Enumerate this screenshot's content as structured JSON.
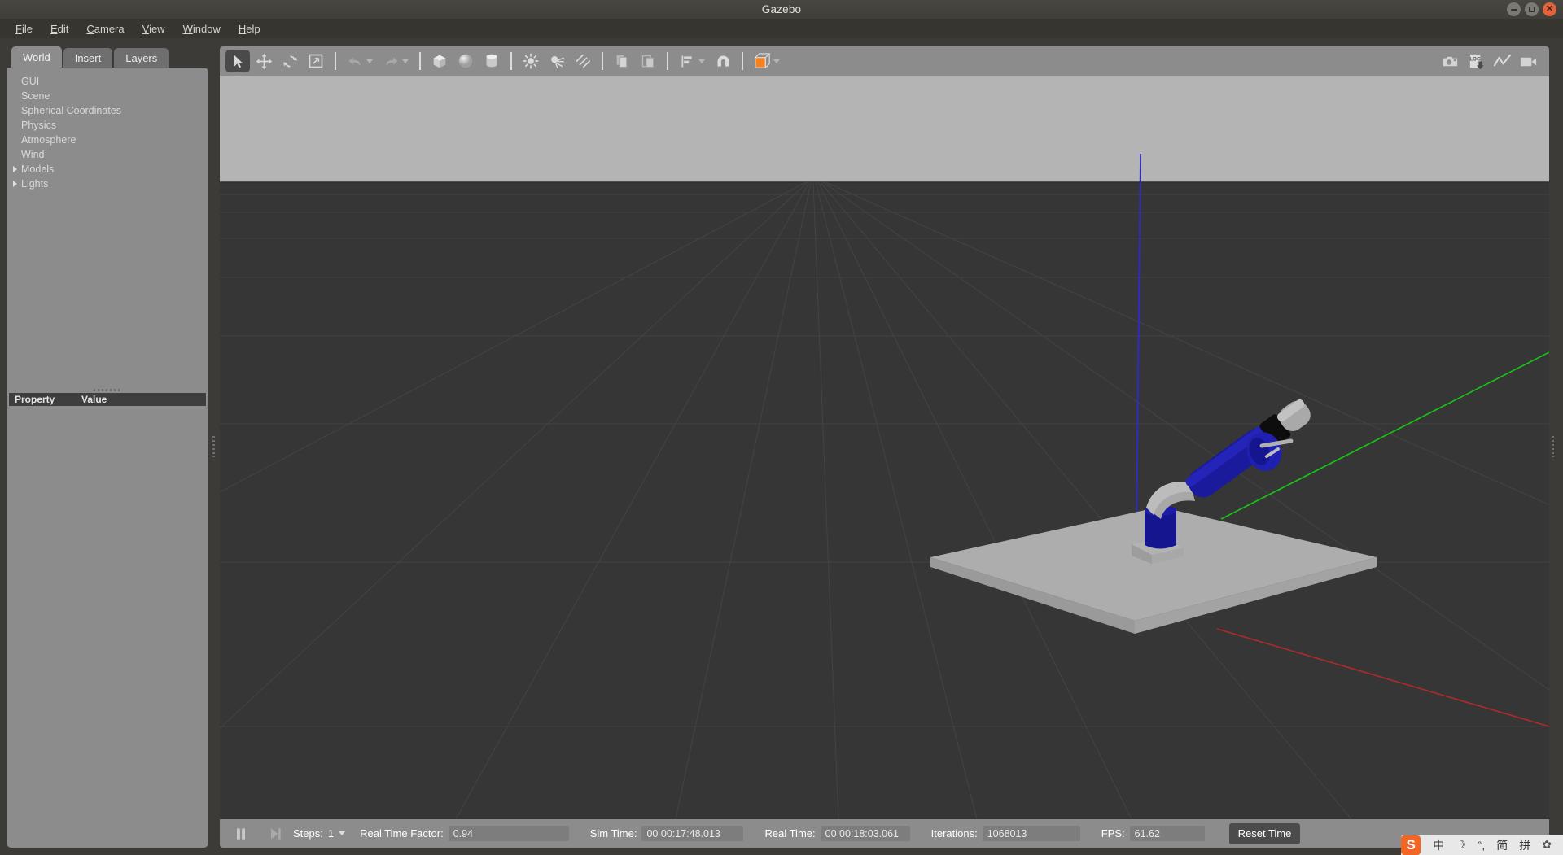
{
  "window": {
    "title": "Gazebo",
    "controls": [
      {
        "name": "minimize",
        "glyph": "dash"
      },
      {
        "name": "maximize",
        "glyph": "square"
      },
      {
        "name": "close",
        "glyph": "x"
      }
    ]
  },
  "menubar": {
    "items": [
      {
        "label": "File",
        "mnemonic": "F"
      },
      {
        "label": "Edit",
        "mnemonic": "E"
      },
      {
        "label": "Camera",
        "mnemonic": "C"
      },
      {
        "label": "View",
        "mnemonic": "V"
      },
      {
        "label": "Window",
        "mnemonic": "W"
      },
      {
        "label": "Help",
        "mnemonic": "H"
      }
    ]
  },
  "left_panel": {
    "tabs": [
      {
        "label": "World",
        "active": true
      },
      {
        "label": "Insert",
        "active": false
      },
      {
        "label": "Layers",
        "active": false
      }
    ],
    "tree": [
      {
        "label": "GUI",
        "expandable": false
      },
      {
        "label": "Scene",
        "expandable": false
      },
      {
        "label": "Spherical Coordinates",
        "expandable": false
      },
      {
        "label": "Physics",
        "expandable": false
      },
      {
        "label": "Atmosphere",
        "expandable": false
      },
      {
        "label": "Wind",
        "expandable": false
      },
      {
        "label": "Models",
        "expandable": true
      },
      {
        "label": "Lights",
        "expandable": true
      }
    ],
    "property_table": {
      "col_property": "Property",
      "col_value": "Value",
      "rows": []
    }
  },
  "toolbar": {
    "left_tools": [
      {
        "name": "select-mode",
        "title": "Selection Mode",
        "active": true
      },
      {
        "name": "translate-mode",
        "title": "Translation Mode",
        "active": false
      },
      {
        "name": "rotate-mode",
        "title": "Rotation Mode",
        "active": false
      },
      {
        "name": "scale-mode",
        "title": "Scale Mode",
        "active": false
      },
      {
        "name": "undo",
        "title": "Undo",
        "active": false
      },
      {
        "name": "undo-history",
        "title": "Undo History",
        "active": false
      },
      {
        "name": "redo",
        "title": "Redo",
        "active": false
      },
      {
        "name": "redo-history",
        "title": "Redo History",
        "active": false
      },
      {
        "name": "insert-box",
        "title": "Box",
        "active": false
      },
      {
        "name": "insert-sphere",
        "title": "Sphere",
        "active": false
      },
      {
        "name": "insert-cylinder",
        "title": "Cylinder",
        "active": false
      },
      {
        "name": "point-light",
        "title": "Point Light",
        "active": false
      },
      {
        "name": "spot-light",
        "title": "Spot Light",
        "active": false
      },
      {
        "name": "directional-light",
        "title": "Directional Light",
        "active": false
      },
      {
        "name": "copy",
        "title": "Copy",
        "active": false
      },
      {
        "name": "paste",
        "title": "Paste",
        "active": false
      },
      {
        "name": "align",
        "title": "Align",
        "active": false
      },
      {
        "name": "snap",
        "title": "Snap",
        "active": false
      },
      {
        "name": "view-mode",
        "title": "View Mode",
        "active": false
      }
    ],
    "right_tools": [
      {
        "name": "screenshot",
        "title": "Take a screenshot"
      },
      {
        "name": "log-record",
        "title": "Log Data"
      },
      {
        "name": "plot",
        "title": "Plot Data"
      },
      {
        "name": "video-record",
        "title": "Record a video"
      }
    ]
  },
  "scene": {
    "sky_color": "#b4b4b4",
    "ground_color": "#363636",
    "grid_color": "#4a4a4a",
    "axis_x_color": "#c03030",
    "axis_y_color": "#14cc14",
    "axis_z_color": "#2222cc",
    "table_top_color": "#aaaaaa",
    "table_edge_color": "#8e8e8e",
    "robot": {
      "name": "robot-arm",
      "link_blue": "#1c1c9e",
      "link_gray": "#a6a6a6",
      "joint_black": "#111111"
    }
  },
  "statusbar": {
    "pause_button": "pause",
    "step_button": "step",
    "steps_label": "Steps:",
    "steps_value": "1",
    "rtf_label": "Real Time Factor:",
    "rtf_value": "0.94",
    "sim_time_label": "Sim Time:",
    "sim_time_value": "00 00:17:48.013",
    "real_time_label": "Real Time:",
    "real_time_value": "00 00:18:03.061",
    "iterations_label": "Iterations:",
    "iterations_value": "1068013",
    "fps_label": "FPS:",
    "fps_value": "61.62",
    "reset_button": "Reset Time"
  },
  "ime": {
    "logo": "S",
    "items": [
      "中",
      "☽",
      "°,",
      "简",
      "拼",
      "✿"
    ]
  }
}
